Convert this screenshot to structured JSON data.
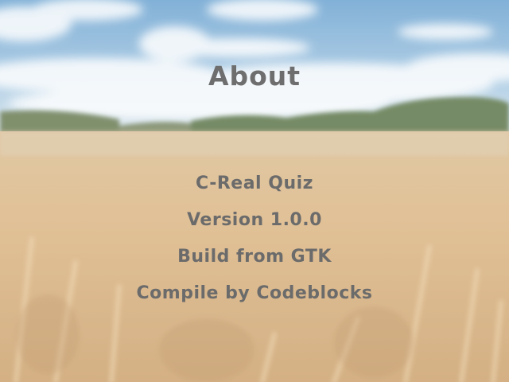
{
  "about": {
    "title": "About",
    "lines": [
      "C-Real Quiz",
      "Version 1.0.0",
      "Build from GTK",
      "Compile by Codeblocks"
    ]
  },
  "background": {
    "scene": "wheat-field-under-blue-sky",
    "sky_color": "#6aa3d3",
    "field_color": "#d9b07a"
  },
  "colors": {
    "text": "#6b6b6b"
  }
}
